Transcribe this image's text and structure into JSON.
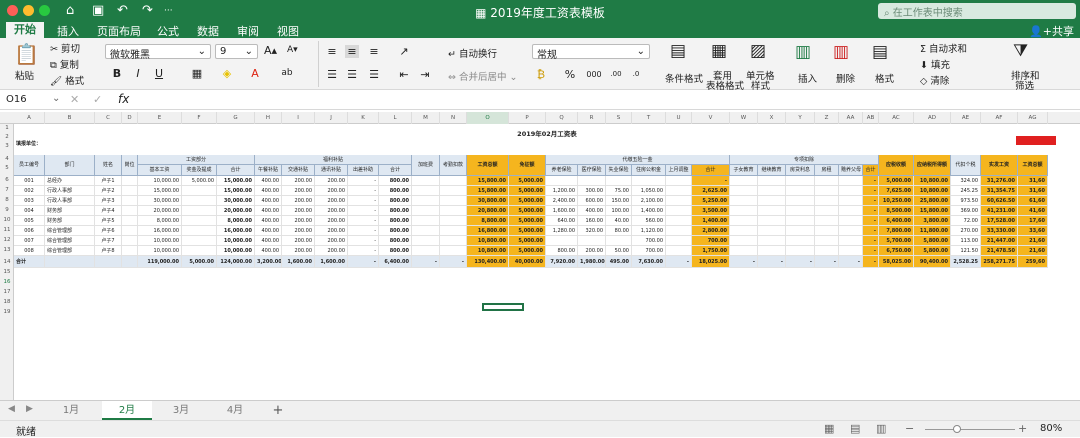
{
  "window": {
    "title": "2019年度工资表模板",
    "search_placeholder": "在工作表中搜索",
    "share": "共享"
  },
  "ribbon_tabs": [
    "开始",
    "插入",
    "页面布局",
    "公式",
    "数据",
    "审阅",
    "视图"
  ],
  "ribbon": {
    "paste": "粘贴",
    "cut": "剪切",
    "copy": "复制",
    "format_painter": "格式",
    "font_name": "微软雅黑",
    "font_size": "9",
    "grow": "A",
    "shrink": "A",
    "bold": "B",
    "italic": "I",
    "underline": "U",
    "wrap": "自动换行",
    "merge": "合并后居中",
    "number_format": "常规",
    "currency": "%",
    "percent": "%",
    "comma": "000",
    "conditional": "条件格式",
    "table_format_1": "套用",
    "table_format_2": "表格格式",
    "cell_style_1": "单元格",
    "cell_style_2": "样式",
    "insert": "插入",
    "delete": "删除",
    "format": "格式",
    "autosum": "自动求和",
    "fill": "填充",
    "clear": "清除",
    "sort_1": "排序和",
    "sort_2": "筛选"
  },
  "formula_bar": {
    "cell_ref": "O16",
    "fx": "fx",
    "formula": ""
  },
  "column_letters": [
    "A",
    "B",
    "C",
    "D",
    "E",
    "F",
    "G",
    "H",
    "I",
    "J",
    "K",
    "L",
    "M",
    "N",
    "O",
    "P",
    "Q",
    "R",
    "S",
    "T",
    "U",
    "V",
    "W",
    "X",
    "Y",
    "Z",
    "AA",
    "AB",
    "AC",
    "AD",
    "AE",
    "AF",
    "AG"
  ],
  "row_numbers": [
    "1",
    "2",
    "3",
    "4",
    "5",
    "6",
    "7",
    "8",
    "9",
    "10",
    "11",
    "12",
    "13",
    "14",
    "15",
    "16",
    "17",
    "18",
    "19"
  ],
  "sheet": {
    "title": "2019年02月工资表",
    "unit_label": "填报单位：",
    "group_headers": [
      "工资部分",
      "福利补贴",
      "代缴五险一金",
      "专项扣除"
    ],
    "headers": [
      "员工编号",
      "部门",
      "姓名",
      "岗位",
      "基本工资",
      "奖金及提成",
      "合计",
      "午餐补贴",
      "交通补贴",
      "通讯补贴",
      "出差补助",
      "合计",
      "加班费",
      "考勤扣款",
      "工资总额",
      "免征额",
      "养老保险",
      "医疗保险",
      "失业保险",
      "住房公积金",
      "上月调整",
      "合计",
      "子女教育",
      "继续教育",
      "房贷利息",
      "房租",
      "赡养父母",
      "合计",
      "应税收额",
      "应纳税所得额",
      "代扣个税",
      "实发工资",
      "工资总额"
    ],
    "rows": [
      [
        "001",
        "总经办",
        "卢子1",
        "",
        "10,000.00",
        "5,000.00",
        "15,000.00",
        "400.00",
        "200.00",
        "200.00",
        "-",
        "800.00",
        "",
        "",
        "15,800.00",
        "5,000.00",
        "",
        "",
        "",
        "",
        "",
        "-",
        "",
        "",
        "",
        "",
        "",
        "-",
        "5,000.00",
        "10,800.00",
        "324.00",
        "31,276.00",
        "31,60"
      ],
      [
        "002",
        "行政人事部",
        "卢子2",
        "",
        "15,000.00",
        "",
        "15,000.00",
        "400.00",
        "200.00",
        "200.00",
        "-",
        "800.00",
        "",
        "",
        "15,800.00",
        "5,000.00",
        "1,200.00",
        "300.00",
        "75.00",
        "1,050.00",
        "",
        "2,625.00",
        "",
        "",
        "",
        "",
        "",
        "-",
        "7,625.00",
        "10,800.00",
        "245.25",
        "31,354.75",
        "31,60"
      ],
      [
        "003",
        "行政人事部",
        "卢子3",
        "",
        "30,000.00",
        "",
        "30,000.00",
        "400.00",
        "200.00",
        "200.00",
        "-",
        "800.00",
        "",
        "",
        "30,800.00",
        "5,000.00",
        "2,400.00",
        "600.00",
        "150.00",
        "2,100.00",
        "",
        "5,250.00",
        "",
        "",
        "",
        "",
        "",
        "-",
        "10,250.00",
        "25,800.00",
        "973.50",
        "60,626.50",
        "61,60"
      ],
      [
        "004",
        "财务部",
        "卢子4",
        "",
        "20,000.00",
        "",
        "20,000.00",
        "400.00",
        "200.00",
        "200.00",
        "-",
        "800.00",
        "",
        "",
        "20,800.00",
        "5,000.00",
        "1,600.00",
        "400.00",
        "100.00",
        "1,400.00",
        "",
        "3,500.00",
        "",
        "",
        "",
        "",
        "",
        "-",
        "8,500.00",
        "15,800.00",
        "369.00",
        "41,231.00",
        "41,60"
      ],
      [
        "005",
        "财务部",
        "卢子5",
        "",
        "8,000.00",
        "",
        "8,000.00",
        "400.00",
        "200.00",
        "200.00",
        "-",
        "800.00",
        "",
        "",
        "8,800.00",
        "5,000.00",
        "640.00",
        "160.00",
        "40.00",
        "560.00",
        "",
        "1,400.00",
        "",
        "",
        "",
        "",
        "",
        "-",
        "6,400.00",
        "3,800.00",
        "72.00",
        "17,528.00",
        "17,60"
      ],
      [
        "006",
        "综合管理部",
        "卢子6",
        "",
        "16,000.00",
        "",
        "16,000.00",
        "400.00",
        "200.00",
        "200.00",
        "-",
        "800.00",
        "",
        "",
        "16,800.00",
        "5,000.00",
        "1,280.00",
        "320.00",
        "80.00",
        "1,120.00",
        "",
        "2,800.00",
        "",
        "",
        "",
        "",
        "",
        "-",
        "7,800.00",
        "11,800.00",
        "270.00",
        "33,330.00",
        "33,60"
      ],
      [
        "007",
        "综合管理部",
        "卢子7",
        "",
        "10,000.00",
        "",
        "10,000.00",
        "400.00",
        "200.00",
        "200.00",
        "-",
        "800.00",
        "",
        "",
        "10,800.00",
        "5,000.00",
        "",
        "",
        "",
        "700.00",
        "",
        "700.00",
        "",
        "",
        "",
        "",
        "",
        "-",
        "5,700.00",
        "5,800.00",
        "113.00",
        "21,447.00",
        "21,60"
      ],
      [
        "008",
        "综合管理部",
        "卢子8",
        "",
        "10,000.00",
        "",
        "10,000.00",
        "400.00",
        "200.00",
        "200.00",
        "-",
        "800.00",
        "",
        "",
        "10,800.00",
        "5,000.00",
        "800.00",
        "200.00",
        "50.00",
        "700.00",
        "",
        "1,750.00",
        "",
        "",
        "",
        "",
        "",
        "-",
        "6,750.00",
        "5,800.00",
        "121.50",
        "21,478.50",
        "21,60"
      ]
    ],
    "total_row": [
      "合计",
      "",
      "",
      "",
      "119,000.00",
      "5,000.00",
      "124,000.00",
      "3,200.00",
      "1,600.00",
      "1,600.00",
      "-",
      "6,400.00",
      "-",
      "-",
      "130,400.00",
      "40,000.00",
      "7,920.00",
      "1,980.00",
      "495.00",
      "7,630.00",
      "-",
      "18,025.00",
      "-",
      "-",
      "-",
      "-",
      "-",
      "-",
      "58,025.00",
      "90,400.00",
      "2,528.25",
      "258,271.75",
      "259,60"
    ]
  },
  "sheet_tabs": [
    "1月",
    "2月",
    "3月",
    "4月",
    "+"
  ],
  "active_sheet": "2月",
  "status": {
    "ready": "就绪",
    "zoom": "80%"
  }
}
